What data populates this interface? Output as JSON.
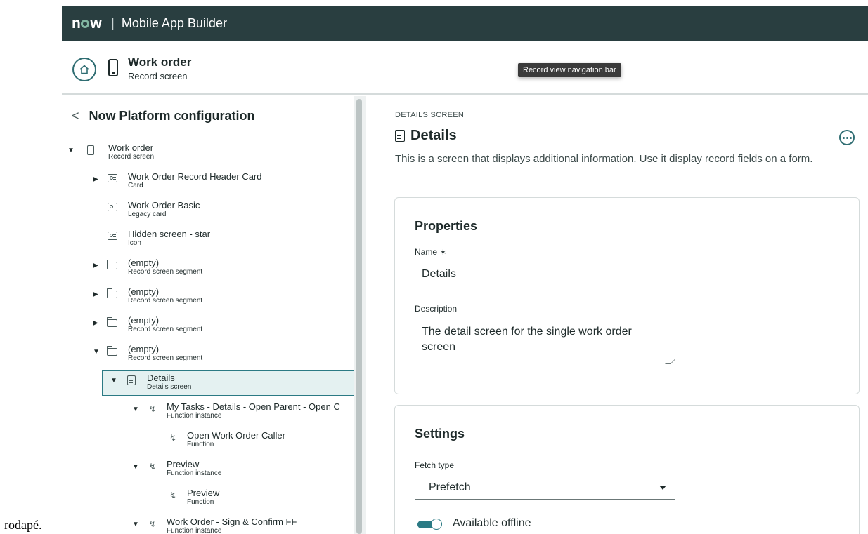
{
  "outside_text": "rodapé.",
  "topbar": {
    "logo": "now",
    "app_name": "Mobile App Builder"
  },
  "header": {
    "title": "Work order",
    "subtitle": "Record screen",
    "tooltip": "Record view navigation bar"
  },
  "left_panel": {
    "title": "Now Platform configuration",
    "tree": [
      {
        "label": "Work order",
        "sub": "Record screen",
        "icon": "phone-icon",
        "caret": "down"
      },
      {
        "label": "Work Order Record Header Card",
        "sub": "Card",
        "icon": "card-icon",
        "caret": "right"
      },
      {
        "label": "Work Order Basic",
        "sub": "Legacy card",
        "icon": "card-icon",
        "caret": ""
      },
      {
        "label": "Hidden screen - star",
        "sub": "Icon",
        "icon": "card-icon",
        "caret": ""
      },
      {
        "label": "(empty)",
        "sub": "Record screen segment",
        "icon": "folder-icon",
        "caret": "right"
      },
      {
        "label": "(empty)",
        "sub": "Record screen segment",
        "icon": "folder-icon",
        "caret": "right"
      },
      {
        "label": "(empty)",
        "sub": "Record screen segment",
        "icon": "folder-icon",
        "caret": "right"
      },
      {
        "label": "(empty)",
        "sub": "Record screen segment",
        "icon": "folder-icon",
        "caret": "down"
      },
      {
        "label": "Details",
        "sub": "Details screen",
        "icon": "document-icon",
        "caret": "down",
        "selected": true
      },
      {
        "label": "My Tasks - Details - Open Parent - Open C",
        "sub": "Function instance",
        "icon": "function-icon",
        "caret": "down"
      },
      {
        "label": "Open Work Order Caller",
        "sub": "Function",
        "icon": "function-icon",
        "caret": ""
      },
      {
        "label": "Preview",
        "sub": "Function instance",
        "icon": "function-icon",
        "caret": "down"
      },
      {
        "label": "Preview",
        "sub": "Function",
        "icon": "function-icon",
        "caret": ""
      },
      {
        "label": "Work Order - Sign & Confirm FF",
        "sub": "Function instance",
        "icon": "function-icon",
        "caret": "down"
      }
    ]
  },
  "details": {
    "caption": "DETAILS SCREEN",
    "title": "Details",
    "description": "This is a screen that displays additional information. Use it display record fields on a form.",
    "properties": {
      "heading": "Properties",
      "name_label": "Name ∗",
      "name_value": "Details",
      "description_label": "Description",
      "description_value": "The detail screen for the single work order screen"
    },
    "settings": {
      "heading": "Settings",
      "fetch_label": "Fetch type",
      "fetch_value": "Prefetch",
      "offline_label": "Available offline",
      "offline_on": true
    }
  }
}
